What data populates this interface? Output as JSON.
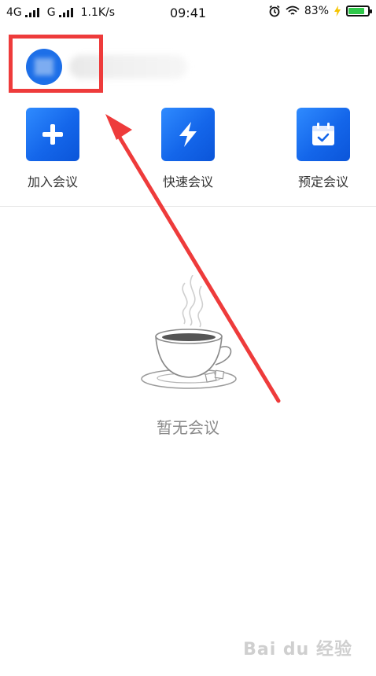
{
  "status_bar": {
    "network1": "4G",
    "network2": "G",
    "speed": "1.1K/s",
    "time": "09:41",
    "battery_percent": "83%",
    "battery_level": 0.83
  },
  "actions": [
    {
      "label": "加入会议",
      "icon": "plus-icon"
    },
    {
      "label": "快速会议",
      "icon": "lightning-icon"
    },
    {
      "label": "预定会议",
      "icon": "calendar-icon"
    }
  ],
  "empty_state": {
    "text": "暂无会议",
    "icon": "coffee-cup-icon"
  },
  "watermark": "Bai du 经验",
  "colors": {
    "accent": "#1466ea",
    "highlight": "#ee3b3b",
    "battery": "#2fc84a"
  }
}
